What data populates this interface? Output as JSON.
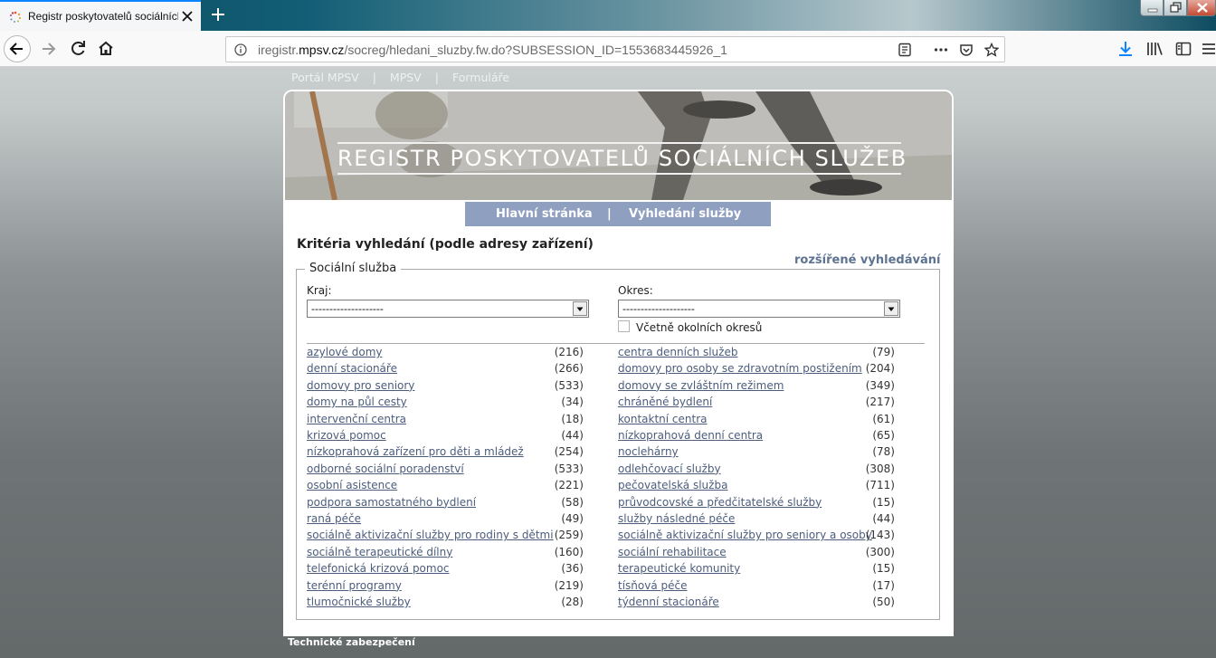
{
  "browser": {
    "tab_title": "Registr poskytovatelů sociálních služeb",
    "url_prefix": "iregistr.",
    "url_host": "mpsv.cz",
    "url_path": "/socreg/hledani_sluzby.fw.do?SUBSESSION_ID=1553683445926_1",
    "accent_color": "#0a84ff"
  },
  "topnav": {
    "items": [
      "Portál MPSV",
      "MPSV",
      "Formuláře"
    ],
    "separator": "|"
  },
  "banner": {
    "title": "REGISTR POSKYTOVATELŮ SOCIÁLNÍCH SLUŽEB"
  },
  "mainnav": {
    "home": "Hlavní stránka",
    "search": "Vyhledání služby",
    "separator": "|",
    "bg_color": "#8f9fbf"
  },
  "heading": "Kritéria vyhledání (podle adresy zařízení)",
  "advanced_link": "rozšířené vyhledávání",
  "fieldset_legend": "Sociální služba",
  "kraj": {
    "label": "Kraj:",
    "value": "--------------------"
  },
  "okres": {
    "label": "Okres:",
    "value": "--------------------",
    "checkbox_label": "Včetně okolních okresů",
    "checked": false
  },
  "services_left": [
    {
      "name": "azylové domy",
      "count": "(216)"
    },
    {
      "name": "denní stacionáře",
      "count": "(266)"
    },
    {
      "name": "domovy pro seniory",
      "count": "(533)"
    },
    {
      "name": "domy na půl cesty",
      "count": "(34)"
    },
    {
      "name": "intervenční centra",
      "count": "(18)"
    },
    {
      "name": "krizová pomoc",
      "count": "(44)"
    },
    {
      "name": "nízkoprahová zařízení pro děti a mládež",
      "count": "(254)"
    },
    {
      "name": "odborné sociální poradenství",
      "count": "(533)"
    },
    {
      "name": "osobní asistence",
      "count": "(221)"
    },
    {
      "name": "podpora samostatného bydlení",
      "count": "(58)"
    },
    {
      "name": "raná péče",
      "count": "(49)"
    },
    {
      "name": "sociálně aktivizační služby pro rodiny s dětmi",
      "count": "(259)"
    },
    {
      "name": "sociálně terapeutické dílny",
      "count": "(160)"
    },
    {
      "name": "telefonická krizová pomoc",
      "count": "(36)"
    },
    {
      "name": "terénní programy",
      "count": "(219)"
    },
    {
      "name": "tlumočnické služby",
      "count": "(28)"
    }
  ],
  "services_right": [
    {
      "name": "centra denních služeb",
      "count": "(79)"
    },
    {
      "name": "domovy pro osoby se zdravotním postižením",
      "count": "(204)"
    },
    {
      "name": "domovy se zvláštním režimem",
      "count": "(349)"
    },
    {
      "name": "chráněné bydlení",
      "count": "(217)"
    },
    {
      "name": "kontaktní centra",
      "count": "(61)"
    },
    {
      "name": "nízkoprahová denní centra",
      "count": "(65)"
    },
    {
      "name": "noclehárny",
      "count": "(78)"
    },
    {
      "name": "odlehčovací služby",
      "count": "(308)"
    },
    {
      "name": "pečovatelská služba",
      "count": "(711)"
    },
    {
      "name": "průvodcovské a předčitatelské služby",
      "count": "(15)"
    },
    {
      "name": "služby následné péče",
      "count": "(44)"
    },
    {
      "name": "sociálně aktivizační služby pro seniory a osoby",
      "count": "(143)"
    },
    {
      "name": "sociální rehabilitace",
      "count": "(300)"
    },
    {
      "name": "terapeutické komunity",
      "count": "(15)"
    },
    {
      "name": "tísňová péče",
      "count": "(17)"
    },
    {
      "name": "týdenní stacionáře",
      "count": "(50)"
    }
  ],
  "link_color": "#4c5d7c",
  "footer": "Technické zabezpečení"
}
